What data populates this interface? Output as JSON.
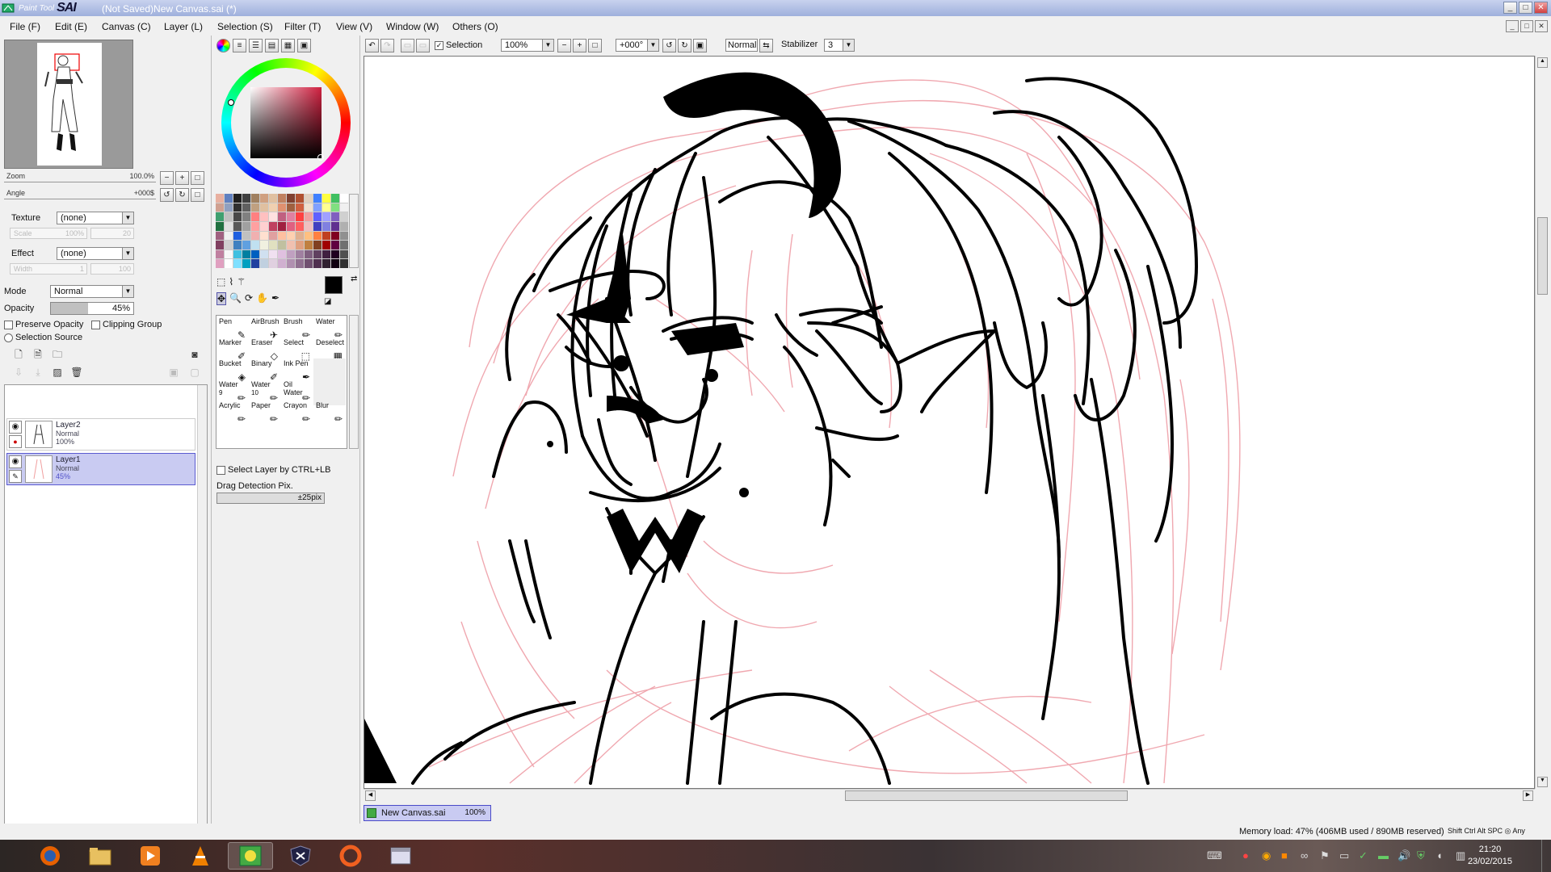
{
  "window": {
    "logo_small": "Paint Tool",
    "logo_big": "SAI",
    "title": "(Not Saved)New Canvas.sai (*)",
    "buttons": [
      "_",
      "□",
      "✕"
    ]
  },
  "menu": [
    "File (F)",
    "Edit (E)",
    "Canvas (C)",
    "Layer (L)",
    "Selection (S)",
    "Filter (T)",
    "View (V)",
    "Window (W)",
    "Others (O)"
  ],
  "navigator": {
    "zoom_label": "Zoom",
    "zoom_value": "100.0%",
    "angle_label": "Angle",
    "angle_value": "+000$"
  },
  "texture": {
    "label": "Texture",
    "value": "(none)",
    "scale_label": "Scale",
    "scale_value": "100%",
    "scale_num": "20"
  },
  "effect": {
    "label": "Effect",
    "value": "(none)",
    "width_label": "Width",
    "width_value": "1",
    "width_num": "100"
  },
  "mode": {
    "label": "Mode",
    "value": "Normal"
  },
  "opacity": {
    "label": "Opacity",
    "value": "45%",
    "fraction": 0.45
  },
  "checks": {
    "preserve_opacity": "Preserve Opacity",
    "clipping_group": "Clipping Group",
    "selection_source": "Selection Source"
  },
  "layers": [
    {
      "name": "Layer2",
      "mode": "Normal",
      "opacity": "100%",
      "selected": false
    },
    {
      "name": "Layer1",
      "mode": "Normal",
      "opacity": "45%",
      "selected": true
    }
  ],
  "tools": [
    {
      "name": "Pen",
      "sub": "",
      "icon": "pen-icon"
    },
    {
      "name": "AirBrush",
      "sub": "",
      "icon": "airbrush-icon"
    },
    {
      "name": "Brush",
      "sub": "",
      "icon": "brush-icon"
    },
    {
      "name": "Water",
      "sub": "",
      "icon": "water-icon"
    },
    {
      "name": "Marker",
      "sub": "",
      "icon": "marker-icon"
    },
    {
      "name": "Eraser",
      "sub": "",
      "icon": "eraser-icon"
    },
    {
      "name": "Select",
      "sub": "",
      "icon": "select-icon"
    },
    {
      "name": "Deselect",
      "sub": "",
      "icon": "deselect-icon"
    },
    {
      "name": "Bucket",
      "sub": "",
      "icon": "bucket-icon"
    },
    {
      "name": "Binary",
      "sub": "",
      "icon": "binary-icon"
    },
    {
      "name": "Ink Pen",
      "sub": "",
      "icon": "ink-pen-icon"
    },
    {
      "name": "",
      "sub": "",
      "icon": ""
    },
    {
      "name": "Water",
      "sub": "9",
      "icon": "water-icon"
    },
    {
      "name": "Water",
      "sub": "10",
      "icon": "water-icon"
    },
    {
      "name": "Oil Water",
      "sub": "",
      "icon": "oil-water-icon"
    },
    {
      "name": "",
      "sub": "",
      "icon": ""
    },
    {
      "name": "Acrylic",
      "sub": "",
      "icon": "acrylic-icon"
    },
    {
      "name": "Paper",
      "sub": "",
      "icon": "paper-icon"
    },
    {
      "name": "Crayon",
      "sub": "",
      "icon": "crayon-icon"
    },
    {
      "name": "Blur",
      "sub": "",
      "icon": "blur-icon"
    }
  ],
  "select_layer_ctrl": "Select Layer by CTRL+LB",
  "drag_detection": {
    "label": "Drag Detection Pix.",
    "value": "±25pix"
  },
  "colors": {
    "primary": "#000000",
    "secondary": "#8b7355"
  },
  "toolbar": {
    "selection_label": "Selection",
    "zoom": "100%",
    "angle": "+000°",
    "blend": "Normal",
    "stabilizer_label": "Stabilizer",
    "stabilizer_value": "3"
  },
  "doc_tab": {
    "name": "New Canvas.sai",
    "zoom": "100%"
  },
  "status": {
    "memory": "Memory load: 47% (406MB used / 890MB reserved)",
    "keys": "Shift Ctrl Alt SPC ◎ Any"
  },
  "taskbar": {
    "apps": [
      "firefox-icon",
      "explorer-icon",
      "media-player-icon",
      "vlc-icon",
      "paint-tool-sai-icon",
      "shield-game-icon",
      "origin-icon",
      "window-icon"
    ],
    "time": "21:20",
    "date": "23/02/2015"
  },
  "palette_colors": [
    "#e8b0a0",
    "#6080c0",
    "#202020",
    "#404040",
    "#a08060",
    "#d0a080",
    "#e0c0a0",
    "#c08060",
    "#804030",
    "#b05030",
    "#e0d0c0",
    "#4080ff",
    "#ffff40",
    "#40c060",
    "#ffffff",
    "#d0a090",
    "#90a0c0",
    "#303030",
    "#606060",
    "#c0a080",
    "#e0c0a0",
    "#f0d0b0",
    "#e09070",
    "#a06040",
    "#d06040",
    "#f0e0d0",
    "#80a0ff",
    "#ffff90",
    "#80e080",
    "#f0f0f0",
    "#40a070",
    "#c0c0c0",
    "#484848",
    "#808080",
    "#ff8080",
    "#ffc0c0",
    "#ffe0e0",
    "#c06080",
    "#e080a0",
    "#ff4040",
    "#f0a0a0",
    "#6060ff",
    "#a0a0ff",
    "#8060c0",
    "#d0d0d0",
    "#207040",
    "#e0e0e0",
    "#585858",
    "#a0a0a0",
    "#ffa0a0",
    "#ffd0d0",
    "#c04060",
    "#a02040",
    "#e06080",
    "#ff6060",
    "#f0c0c0",
    "#4040c0",
    "#8080e0",
    "#603090",
    "#b0b0b0",
    "#a06080",
    "#f0f0f0",
    "#2060e0",
    "#c0c0c0",
    "#f0b0b0",
    "#ffe0d0",
    "#e0a0a0",
    "#ffc0a0",
    "#ffd0b0",
    "#e0b090",
    "#ffc080",
    "#ff8040",
    "#c04020",
    "#800020",
    "#909090",
    "#804060",
    "#d0d0d0",
    "#4080c0",
    "#60a0e0",
    "#c0e0f0",
    "#f0f0e0",
    "#e0e0c0",
    "#c0c0a0",
    "#f0c0b0",
    "#e0a080",
    "#c08040",
    "#804020",
    "#a00000",
    "#600040",
    "#707070",
    "#c080a0",
    "#f8f8f8",
    "#40c0e0",
    "#0080a0",
    "#0060c0",
    "#d0e0f0",
    "#f0e0f0",
    "#e0c0e0",
    "#c0a0c0",
    "#a080a0",
    "#806080",
    "#604060",
    "#402040",
    "#200020",
    "#505050",
    "#e0a0c0",
    "#ffffff",
    "#80e0ff",
    "#00a0c0",
    "#2040a0",
    "#c0d0e0",
    "#e0d0e0",
    "#d0b0d0",
    "#b090b0",
    "#907090",
    "#705070",
    "#503050",
    "#302030",
    "#100010",
    "#303030"
  ]
}
